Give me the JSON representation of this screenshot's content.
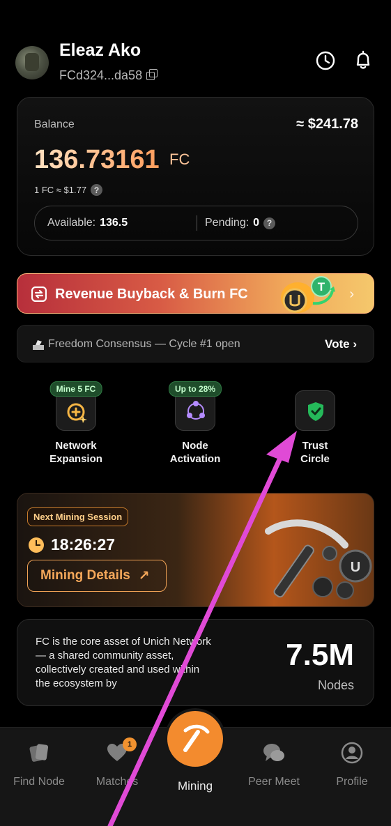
{
  "header": {
    "username": "Eleaz Ako",
    "wallet": "FCd324...da58",
    "icons": [
      "history-clock-icon",
      "bell-icon"
    ]
  },
  "balance": {
    "label": "Balance",
    "usd_value": "≈ $241.78",
    "amount": "136.73161",
    "unit": "FC",
    "rate": "1 FC ≈ $1.77",
    "available_label": "Available:",
    "available_value": "136.5",
    "pending_label": "Pending:",
    "pending_value": "0"
  },
  "buyback": {
    "label": "Revenue Buyback & Burn FC",
    "chevron": "›"
  },
  "consensus": {
    "label": "Freedom Consensus — Cycle #1 open",
    "action": "Vote ›"
  },
  "features": [
    {
      "badge": "Mine 5 FC",
      "label": "Network\nExpansion",
      "icon": "plus-coin-icon"
    },
    {
      "badge": "Up to 28%",
      "label": "Node\nActivation",
      "icon": "node-network-icon"
    },
    {
      "badge": "",
      "label": "Trust\nCircle",
      "icon": "shield-check-icon"
    }
  ],
  "mining": {
    "badge": "Next Mining Session",
    "timer": "18:26:27",
    "details_button": "Mining Details",
    "details_arrow": "↗"
  },
  "info": {
    "text": "FC is the core asset of Unich Network — a shared community asset, collectively created and used within the ecosystem by",
    "nodes_count": "7.5M",
    "nodes_label": "Nodes"
  },
  "tabs": {
    "find_node": "Find Node",
    "matches": "Matches",
    "matches_badge": "1",
    "mining": "Mining",
    "peer_meet": "Peer Meet",
    "profile": "Profile"
  },
  "colors": {
    "accent": "#f38b2e",
    "badge_green": "#1f4d2b",
    "annotation_arrow": "#e04ad6"
  }
}
